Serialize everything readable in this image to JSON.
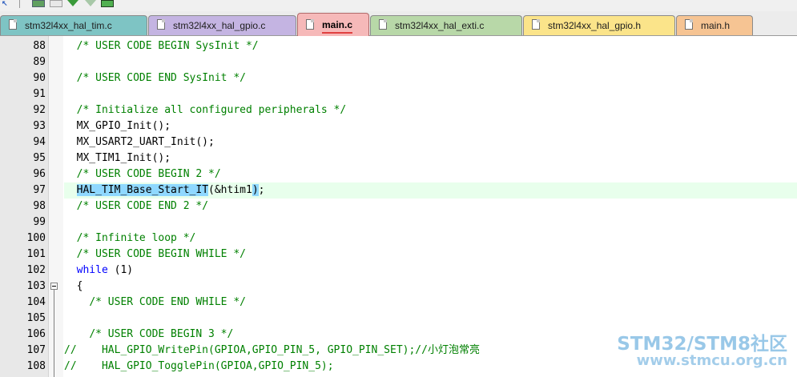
{
  "tabs": [
    {
      "label": "stm32l4xx_hal_tim.c",
      "color": "#7ec4c4",
      "active": false
    },
    {
      "label": "stm32l4xx_hal_gpio.c",
      "color": "#c4b4e2",
      "active": false
    },
    {
      "label": "main.c",
      "color": "#f6b9b9",
      "active": true
    },
    {
      "label": "stm32l4xx_hal_exti.c",
      "color": "#b8d8a8",
      "active": false
    },
    {
      "label": "stm32l4xx_hal_gpio.h",
      "color": "#fbe48a",
      "active": false
    },
    {
      "label": "main.h",
      "color": "#f6c493",
      "active": false
    }
  ],
  "lines": [
    {
      "n": "88",
      "t": "  /* USER CODE BEGIN SysInit */"
    },
    {
      "n": "89",
      "t": ""
    },
    {
      "n": "90",
      "t": "  /* USER CODE END SysInit */"
    },
    {
      "n": "91",
      "t": ""
    },
    {
      "n": "92",
      "t": "  /* Initialize all configured peripherals */"
    },
    {
      "n": "93",
      "t": "  MX_GPIO_Init();"
    },
    {
      "n": "94",
      "t": "  MX_USART2_UART_Init();"
    },
    {
      "n": "95",
      "t": "  MX_TIM1_Init();"
    },
    {
      "n": "96",
      "t": "  /* USER CODE BEGIN 2 */"
    },
    {
      "n": "97",
      "t": "  HAL_TIM_Base_Start_IT(&htim1);"
    },
    {
      "n": "98",
      "t": "  /* USER CODE END 2 */"
    },
    {
      "n": "99",
      "t": ""
    },
    {
      "n": "100",
      "t": "  /* Infinite loop */"
    },
    {
      "n": "101",
      "t": "  /* USER CODE BEGIN WHILE */"
    },
    {
      "n": "102",
      "t": "  while (1)"
    },
    {
      "n": "103",
      "t": "  {"
    },
    {
      "n": "104",
      "t": "    /* USER CODE END WHILE */"
    },
    {
      "n": "105",
      "t": ""
    },
    {
      "n": "106",
      "t": "    /* USER CODE BEGIN 3 */"
    },
    {
      "n": "107",
      "t": "//    HAL_GPIO_WritePin(GPIOA,GPIO_PIN_5, GPIO_PIN_SET);//小灯泡常亮"
    },
    {
      "n": "108",
      "t": "//    HAL_GPIO_TogglePin(GPIOA,GPIO_PIN_5);"
    }
  ],
  "current_line": "97",
  "fold_line": "103",
  "watermark": {
    "title": "STM32/STM8社区",
    "url": "www.stmcu.org.cn"
  },
  "colors": {
    "comment": "#008000",
    "keyword": "#0000ff",
    "selection": "#8fd8ff",
    "current_line": "#e8ffec"
  }
}
